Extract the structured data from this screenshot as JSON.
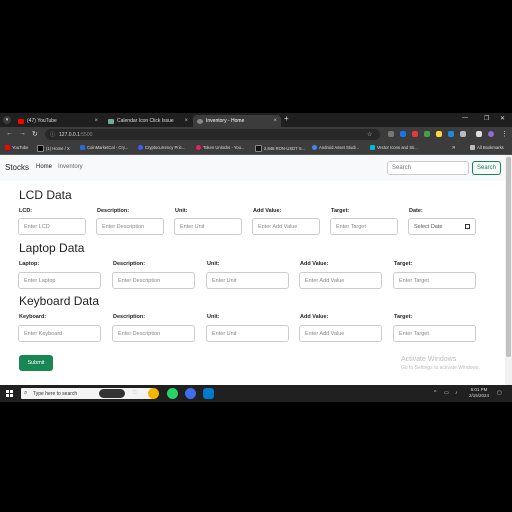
{
  "browser": {
    "tabs": [
      {
        "label": "(47) YouTube",
        "color": "#ff0000"
      },
      {
        "label": "Calendar Icon Click Issue",
        "color": "#74aa9c"
      },
      {
        "label": "Inventory - Home",
        "color": "#888888"
      }
    ],
    "url_host": "127.0.0.1",
    "url_port": ":5500",
    "bookmarks": [
      {
        "label": "YouTube",
        "color": "#ff0000"
      },
      {
        "label": "(1) Home / X",
        "color": "#000000"
      },
      {
        "label": "CoinMarketCal - Cry...",
        "color": "#2a6ad6"
      },
      {
        "label": "Cryptocurrency Pric...",
        "color": "#3861fb"
      },
      {
        "label": "Token Unlocks - You...",
        "color": "#e91e63"
      },
      {
        "label": "2,848 RON-USDT S...",
        "color": "#111111"
      },
      {
        "label": "Android Asset Studi...",
        "color": "#4285f4"
      },
      {
        "label": "Vector Icons and Sti...",
        "color": "#00bcd4"
      }
    ],
    "all_bookmarks": "All Bookmarks"
  },
  "navbar": {
    "brand": "Stocks",
    "links": [
      "Home",
      "Inventory"
    ],
    "search_placeholder": "Search",
    "search_button": "Search"
  },
  "sections": [
    {
      "title": "LCD Data",
      "fields": [
        {
          "label": "LCD:",
          "placeholder": "Enter LCD"
        },
        {
          "label": "Description:",
          "placeholder": "Enter Description"
        },
        {
          "label": "Unit:",
          "placeholder": "Enter Unit"
        },
        {
          "label": "Add Value:",
          "placeholder": "Enter Add Value"
        },
        {
          "label": "Target:",
          "placeholder": "Enter Target"
        },
        {
          "label": "Date:",
          "placeholder": "Select Date"
        }
      ]
    },
    {
      "title": "Laptop Data",
      "fields": [
        {
          "label": "Laptop:",
          "placeholder": "Enter Laptop"
        },
        {
          "label": "Description:",
          "placeholder": "Enter Description"
        },
        {
          "label": "Unit:",
          "placeholder": "Enter Unit"
        },
        {
          "label": "Add Value:",
          "placeholder": "Enter Add Value"
        },
        {
          "label": "Target:",
          "placeholder": "Enter Target"
        }
      ]
    },
    {
      "title": "Keyboard Data",
      "fields": [
        {
          "label": "Keyboard:",
          "placeholder": "Enter Keyboard"
        },
        {
          "label": "Description:",
          "placeholder": "Enter Description"
        },
        {
          "label": "Unit:",
          "placeholder": "Enter Unit"
        },
        {
          "label": "Add Value:",
          "placeholder": "Enter Add Value"
        },
        {
          "label": "Target:",
          "placeholder": "Enter Target"
        }
      ]
    }
  ],
  "submit_label": "Submit",
  "watermark": {
    "line1": "Activate Windows",
    "line2": "Go to Settings to activate Windows."
  },
  "taskbar": {
    "search_placeholder": "Type here to search",
    "time": "6:01 PM",
    "date": "2/15/2024"
  },
  "colors": {
    "accent": "#198754"
  }
}
